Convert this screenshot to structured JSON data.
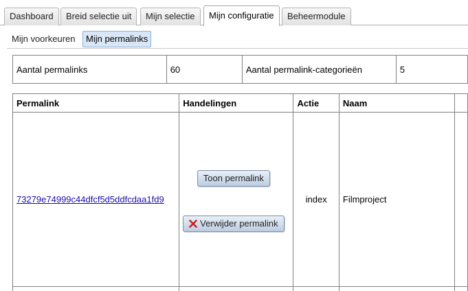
{
  "top_tabs": [
    {
      "label": "Dashboard",
      "active": false
    },
    {
      "label": "Breid selectie uit",
      "active": false
    },
    {
      "label": "Mijn selectie",
      "active": false
    },
    {
      "label": "Mijn configuratie",
      "active": true
    },
    {
      "label": "Beheermodule",
      "active": false
    }
  ],
  "sub_tabs": [
    {
      "label": "Mijn voorkeuren",
      "active": false
    },
    {
      "label": "Mijn permalinks",
      "active": true
    }
  ],
  "stats": {
    "permalink_count_label": "Aantal permalinks",
    "permalink_count_value": "60",
    "category_count_label": "Aantal permalink-categorieën",
    "category_count_value": "5"
  },
  "permalinks_table": {
    "headers": [
      "Permalink",
      "Handelingen",
      "Actie",
      "Naam"
    ],
    "rows": [
      {
        "permalink": "73279e74999c44dfcf5d5ddfcdaa1fd9",
        "show_button": "Toon permalink",
        "delete_button": "Verwijder permalink",
        "action": "index",
        "name": "Filmproject"
      }
    ]
  },
  "colors": {
    "link": "#1a0dab",
    "delete_icon": "#cc1f1f",
    "active_subtab_bg": "#d8e6f5"
  },
  "icons": {
    "delete": "red-x-icon"
  }
}
